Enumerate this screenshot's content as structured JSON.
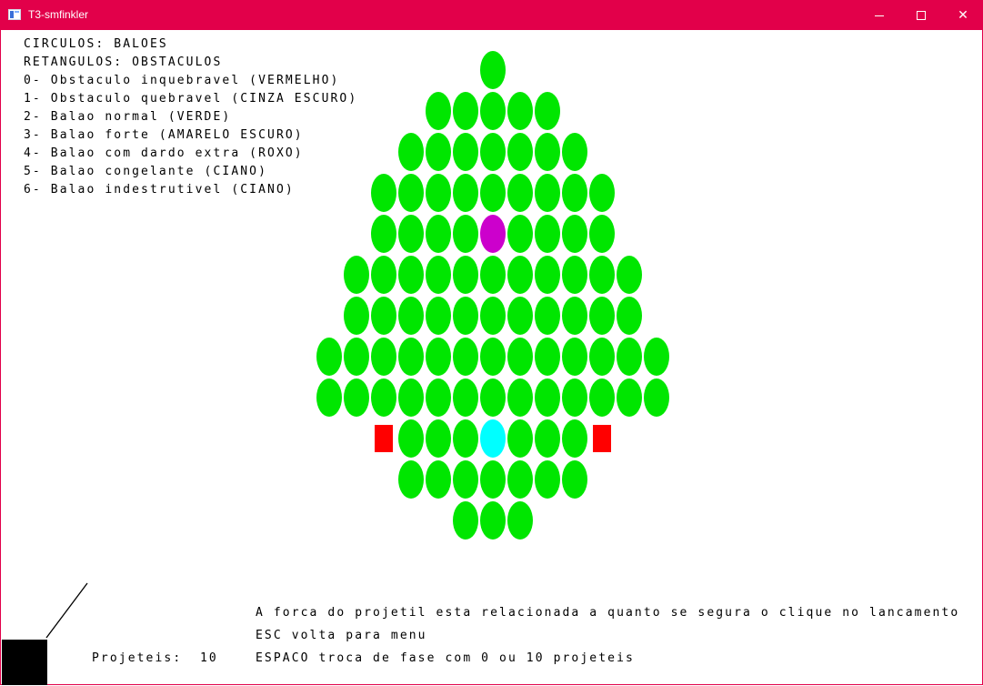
{
  "window": {
    "title": "T3-smfinkler",
    "controls": {
      "minimize": "—",
      "maximize": "☐",
      "close": "✕"
    },
    "accent_color": "#e2004a"
  },
  "legend": {
    "lines": [
      "CIRCULOS: BALOES",
      "RETANGULOS: OBSTACULOS",
      "0- Obstaculo inquebravel (VERMELHO)",
      "1- Obstaculo quebravel (CINZA ESCURO)",
      "2- Balao normal (VERDE)",
      "3- Balao forte (AMARELO ESCURO)",
      "4- Balao com dardo extra (ROXO)",
      "5- Balao congelante (CIANO)",
      "6- Balao indestrutivel (CIANO)"
    ]
  },
  "hud": {
    "projeteis_label": "Projeteis:",
    "projeteis_value": "10",
    "info_lines": [
      "A forca do projetil esta relacionada a quanto se segura o clique no lancamento",
      "ESC volta para menu",
      "ESPACO troca de fase com 0 ou 10 projeteis"
    ]
  },
  "colors": {
    "normal": "#00e600",
    "extra_dart": "#cc00cc",
    "freezing": "#00ffff",
    "unbreakable": "#ff0000",
    "launcher": "#000000"
  },
  "board": {
    "rows": [
      ".....B.....",
      "...BBBBB...",
      "..BBBBBBB..",
      ".BBBBBBBBB.",
      ".BBBBPBBBB.",
      "BBBBBBBBBBB",
      "BBBBBBBBBBB",
      "BBBBBBBBBBBBB",
      "BBBBBBBBBBBBB",
      ".RBBBCBBBR.",
      "..BBBBBBB..",
      "....BBB...."
    ],
    "legend_codes": {
      "B": "normal",
      "P": "extra_dart",
      "C": "freezing",
      "R": "unbreakable"
    }
  }
}
